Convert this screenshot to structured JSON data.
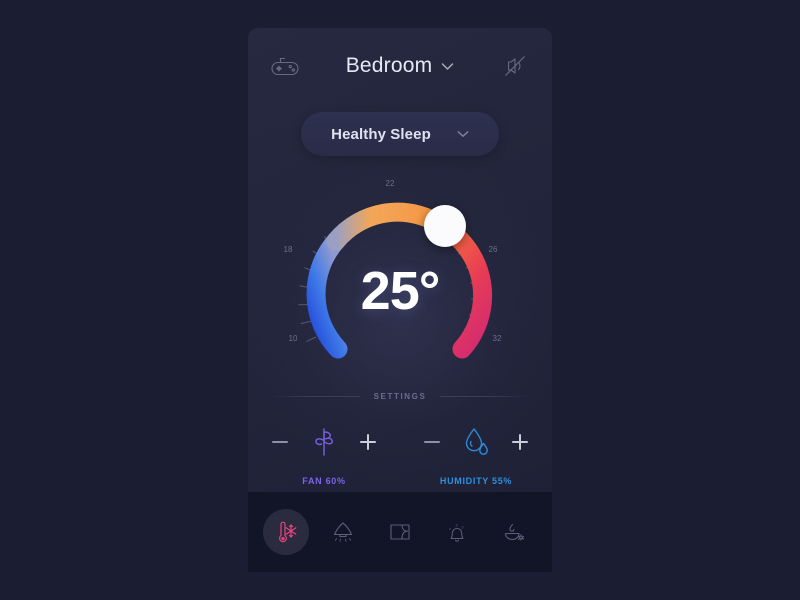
{
  "app": {
    "background_color": "#1b1d33",
    "card_color": "#242640"
  },
  "header": {
    "left_icon": "game-controller-icon",
    "title": "Bedroom",
    "title_chevron": "chevron-down-icon",
    "right_icon": "notification-muted-icon"
  },
  "mode": {
    "label": "Healthy Sleep",
    "chevron": "chevron-down-icon"
  },
  "gauge": {
    "temperature": "25°",
    "value": 25,
    "unit": "°C",
    "min": 10,
    "max": 32,
    "tick_labels": [
      "10",
      "18",
      "22",
      "26",
      "32"
    ],
    "knob": "temperature-knob",
    "cold_color": "#2f5fe8",
    "warm_color": "#f5a04a",
    "hot_color": "#e2315f"
  },
  "settings": {
    "divider_label": "SETTINGS"
  },
  "controls": [
    {
      "key": "fan",
      "icon": "fan-icon",
      "label": "FAN 60%",
      "value": 60,
      "color": "#7d63e8",
      "minus": "minus-icon",
      "plus": "plus-icon"
    },
    {
      "key": "humidity",
      "icon": "water-drop-icon",
      "label": "HUMIDITY 55%",
      "value": 55,
      "color": "#2f8fe0",
      "minus": "minus-icon",
      "plus": "plus-icon"
    }
  ],
  "tabs": [
    {
      "key": "climate",
      "icon": "thermometer-snowflake-icon",
      "active": true,
      "color": "#e8457f"
    },
    {
      "key": "light",
      "icon": "lamp-icon",
      "active": false,
      "color": "#6e7392"
    },
    {
      "key": "curtains",
      "icon": "window-curtain-icon",
      "active": false,
      "color": "#6e7392"
    },
    {
      "key": "alarm",
      "icon": "sleep-bell-icon",
      "active": false,
      "color": "#6e7392"
    },
    {
      "key": "diffuser",
      "icon": "aroma-diffuser-icon",
      "active": false,
      "color": "#6e7392"
    }
  ]
}
